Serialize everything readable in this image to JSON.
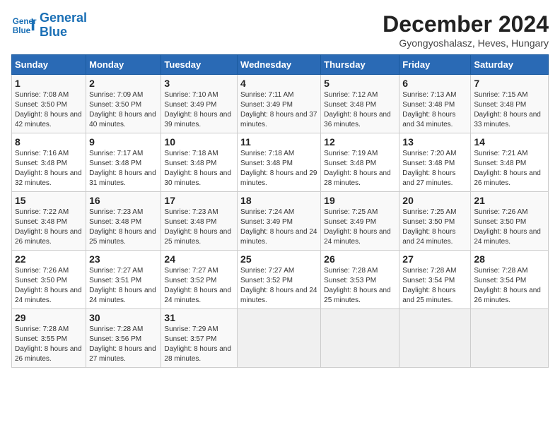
{
  "logo": {
    "line1": "General",
    "line2": "Blue"
  },
  "title": "December 2024",
  "subtitle": "Gyongyoshalasz, Heves, Hungary",
  "days_header": [
    "Sunday",
    "Monday",
    "Tuesday",
    "Wednesday",
    "Thursday",
    "Friday",
    "Saturday"
  ],
  "weeks": [
    [
      {
        "num": "1",
        "sunrise": "Sunrise: 7:08 AM",
        "sunset": "Sunset: 3:50 PM",
        "daylight": "Daylight: 8 hours and 42 minutes."
      },
      {
        "num": "2",
        "sunrise": "Sunrise: 7:09 AM",
        "sunset": "Sunset: 3:50 PM",
        "daylight": "Daylight: 8 hours and 40 minutes."
      },
      {
        "num": "3",
        "sunrise": "Sunrise: 7:10 AM",
        "sunset": "Sunset: 3:49 PM",
        "daylight": "Daylight: 8 hours and 39 minutes."
      },
      {
        "num": "4",
        "sunrise": "Sunrise: 7:11 AM",
        "sunset": "Sunset: 3:49 PM",
        "daylight": "Daylight: 8 hours and 37 minutes."
      },
      {
        "num": "5",
        "sunrise": "Sunrise: 7:12 AM",
        "sunset": "Sunset: 3:48 PM",
        "daylight": "Daylight: 8 hours and 36 minutes."
      },
      {
        "num": "6",
        "sunrise": "Sunrise: 7:13 AM",
        "sunset": "Sunset: 3:48 PM",
        "daylight": "Daylight: 8 hours and 34 minutes."
      },
      {
        "num": "7",
        "sunrise": "Sunrise: 7:15 AM",
        "sunset": "Sunset: 3:48 PM",
        "daylight": "Daylight: 8 hours and 33 minutes."
      }
    ],
    [
      {
        "num": "8",
        "sunrise": "Sunrise: 7:16 AM",
        "sunset": "Sunset: 3:48 PM",
        "daylight": "Daylight: 8 hours and 32 minutes."
      },
      {
        "num": "9",
        "sunrise": "Sunrise: 7:17 AM",
        "sunset": "Sunset: 3:48 PM",
        "daylight": "Daylight: 8 hours and 31 minutes."
      },
      {
        "num": "10",
        "sunrise": "Sunrise: 7:18 AM",
        "sunset": "Sunset: 3:48 PM",
        "daylight": "Daylight: 8 hours and 30 minutes."
      },
      {
        "num": "11",
        "sunrise": "Sunrise: 7:18 AM",
        "sunset": "Sunset: 3:48 PM",
        "daylight": "Daylight: 8 hours and 29 minutes."
      },
      {
        "num": "12",
        "sunrise": "Sunrise: 7:19 AM",
        "sunset": "Sunset: 3:48 PM",
        "daylight": "Daylight: 8 hours and 28 minutes."
      },
      {
        "num": "13",
        "sunrise": "Sunrise: 7:20 AM",
        "sunset": "Sunset: 3:48 PM",
        "daylight": "Daylight: 8 hours and 27 minutes."
      },
      {
        "num": "14",
        "sunrise": "Sunrise: 7:21 AM",
        "sunset": "Sunset: 3:48 PM",
        "daylight": "Daylight: 8 hours and 26 minutes."
      }
    ],
    [
      {
        "num": "15",
        "sunrise": "Sunrise: 7:22 AM",
        "sunset": "Sunset: 3:48 PM",
        "daylight": "Daylight: 8 hours and 26 minutes."
      },
      {
        "num": "16",
        "sunrise": "Sunrise: 7:23 AM",
        "sunset": "Sunset: 3:48 PM",
        "daylight": "Daylight: 8 hours and 25 minutes."
      },
      {
        "num": "17",
        "sunrise": "Sunrise: 7:23 AM",
        "sunset": "Sunset: 3:48 PM",
        "daylight": "Daylight: 8 hours and 25 minutes."
      },
      {
        "num": "18",
        "sunrise": "Sunrise: 7:24 AM",
        "sunset": "Sunset: 3:49 PM",
        "daylight": "Daylight: 8 hours and 24 minutes."
      },
      {
        "num": "19",
        "sunrise": "Sunrise: 7:25 AM",
        "sunset": "Sunset: 3:49 PM",
        "daylight": "Daylight: 8 hours and 24 minutes."
      },
      {
        "num": "20",
        "sunrise": "Sunrise: 7:25 AM",
        "sunset": "Sunset: 3:50 PM",
        "daylight": "Daylight: 8 hours and 24 minutes."
      },
      {
        "num": "21",
        "sunrise": "Sunrise: 7:26 AM",
        "sunset": "Sunset: 3:50 PM",
        "daylight": "Daylight: 8 hours and 24 minutes."
      }
    ],
    [
      {
        "num": "22",
        "sunrise": "Sunrise: 7:26 AM",
        "sunset": "Sunset: 3:50 PM",
        "daylight": "Daylight: 8 hours and 24 minutes."
      },
      {
        "num": "23",
        "sunrise": "Sunrise: 7:27 AM",
        "sunset": "Sunset: 3:51 PM",
        "daylight": "Daylight: 8 hours and 24 minutes."
      },
      {
        "num": "24",
        "sunrise": "Sunrise: 7:27 AM",
        "sunset": "Sunset: 3:52 PM",
        "daylight": "Daylight: 8 hours and 24 minutes."
      },
      {
        "num": "25",
        "sunrise": "Sunrise: 7:27 AM",
        "sunset": "Sunset: 3:52 PM",
        "daylight": "Daylight: 8 hours and 24 minutes."
      },
      {
        "num": "26",
        "sunrise": "Sunrise: 7:28 AM",
        "sunset": "Sunset: 3:53 PM",
        "daylight": "Daylight: 8 hours and 25 minutes."
      },
      {
        "num": "27",
        "sunrise": "Sunrise: 7:28 AM",
        "sunset": "Sunset: 3:54 PM",
        "daylight": "Daylight: 8 hours and 25 minutes."
      },
      {
        "num": "28",
        "sunrise": "Sunrise: 7:28 AM",
        "sunset": "Sunset: 3:54 PM",
        "daylight": "Daylight: 8 hours and 26 minutes."
      }
    ],
    [
      {
        "num": "29",
        "sunrise": "Sunrise: 7:28 AM",
        "sunset": "Sunset: 3:55 PM",
        "daylight": "Daylight: 8 hours and 26 minutes."
      },
      {
        "num": "30",
        "sunrise": "Sunrise: 7:28 AM",
        "sunset": "Sunset: 3:56 PM",
        "daylight": "Daylight: 8 hours and 27 minutes."
      },
      {
        "num": "31",
        "sunrise": "Sunrise: 7:29 AM",
        "sunset": "Sunset: 3:57 PM",
        "daylight": "Daylight: 8 hours and 28 minutes."
      },
      null,
      null,
      null,
      null
    ]
  ]
}
